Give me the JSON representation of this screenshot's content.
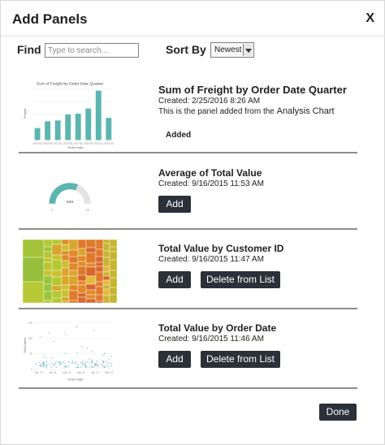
{
  "dialog": {
    "title": "Add Panels",
    "close_label": "X"
  },
  "toolbar": {
    "find_label": "Find",
    "search_placeholder": "Type to search...",
    "sort_label": "Sort By",
    "sort_value": "Newest"
  },
  "panels": [
    {
      "title": "Sum of Freight by Order Date Quarter",
      "created": "Created: 2/25/2016 8:26 AM",
      "description_prefix": "This is the panel added from the ",
      "description_strong": "Analysis Chart",
      "status": "Added",
      "thumbnail": {
        "type": "bar",
        "title": "Sum of Freight by Order Date Quarter",
        "ylabel": "Freight",
        "xlabel": "Order Date",
        "categories": [
          "2010-Q3",
          "2010-Q4",
          "2011-Q1",
          "2011-Q2",
          "2011-Q3",
          "2011-Q4",
          "2012-Q1",
          "2012-Q2"
        ],
        "values": [
          14,
          22,
          23,
          30,
          31,
          37,
          58,
          26
        ],
        "ylim": [
          0,
          60
        ],
        "color": "#5bb5b1"
      }
    },
    {
      "title": "Average of Total Value",
      "created": "Created: 9/16/2015 11:53 AM",
      "add_label": "Add",
      "thumbnail": {
        "type": "gauge",
        "value_label": "629",
        "min_label": "0",
        "max_label": "1k",
        "fraction": 0.63,
        "color": "#5bb5b1"
      }
    },
    {
      "title": "Total Value by Customer ID",
      "created": "Created: 9/16/2015 11:47 AM",
      "add_label": "Add",
      "delete_label": "Delete from List",
      "thumbnail": {
        "type": "treemap"
      }
    },
    {
      "title": "Total Value by Order Date",
      "created": "Created: 9/16/2015 11:46 AM",
      "add_label": "Add",
      "delete_label": "Delete from List",
      "thumbnail": {
        "type": "scatter",
        "ylabel": "Total Value",
        "xlabel": "Order Date",
        "ticks_x": [
          "Sep '10",
          "Jan '11",
          "May '11",
          "Sep '11",
          "Jan '12",
          "May '12"
        ],
        "ticks_y": [
          "15k",
          "10k",
          "5k",
          "0"
        ],
        "color": "#5bb5b1"
      }
    }
  ],
  "footer": {
    "done_label": "Done"
  }
}
